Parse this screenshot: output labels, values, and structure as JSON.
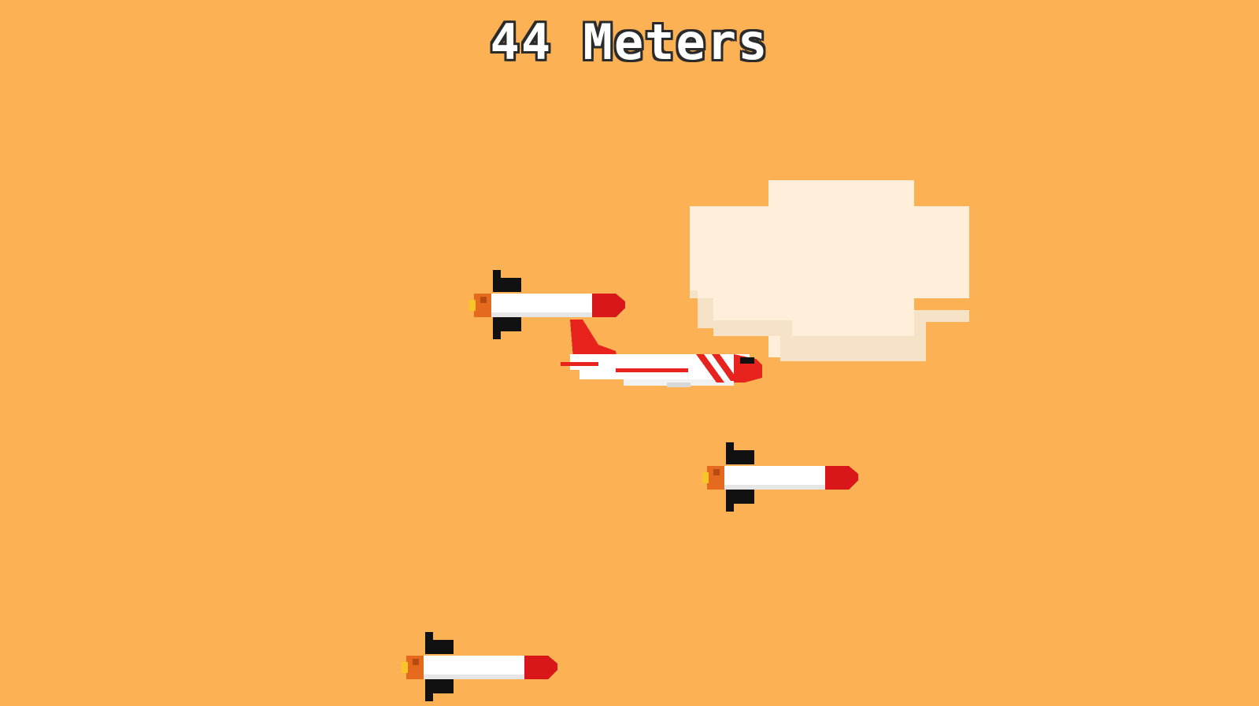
{
  "hud": {
    "distance_text": "44 Meters"
  },
  "colors": {
    "sky": "#FCB155",
    "cloud": "#FFEEDA",
    "cloud_shade": "#F6E2C6",
    "plane_red": "#E8231E",
    "plane_white": "#FFFFFF",
    "missile_body": "#FFFFFF",
    "missile_tip": "#D9161A",
    "missile_fin": "#111111",
    "flame_orange": "#E56A1E",
    "flame_yellow": "#F7C52A"
  },
  "sprites": {
    "cloud": "cloud-icon",
    "player": "plane-icon",
    "missiles": [
      "missile-icon",
      "missile-icon",
      "missile-icon"
    ]
  }
}
